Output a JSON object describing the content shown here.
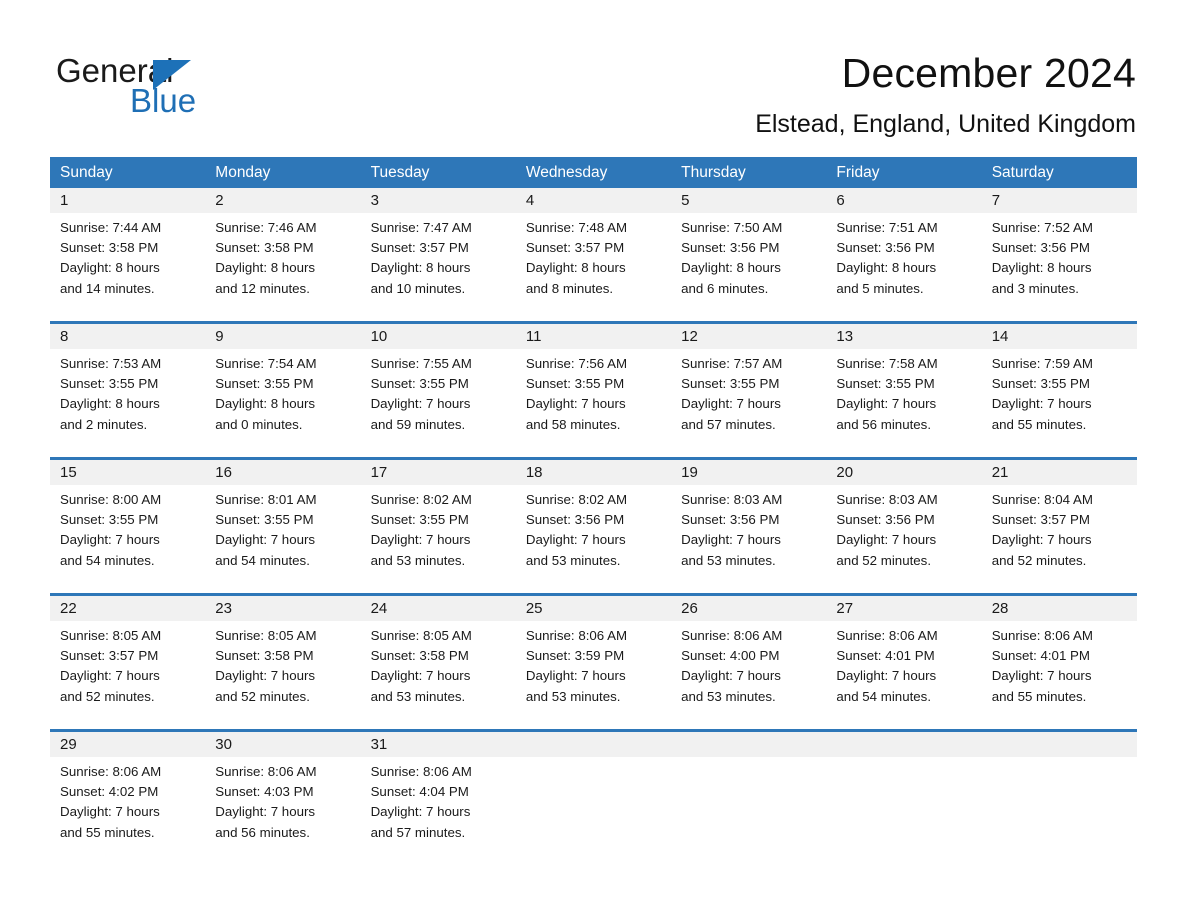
{
  "brand": {
    "name_part1": "General",
    "name_part2": "Blue",
    "accent_color": "#1d71b8"
  },
  "header": {
    "month_title": "December 2024",
    "location": "Elstead, England, United Kingdom"
  },
  "theme": {
    "header_blue": "#2e77b8",
    "date_band_gray": "#f1f1f1",
    "text_dark": "#1a1a1a"
  },
  "calendar": {
    "weekdays": [
      "Sunday",
      "Monday",
      "Tuesday",
      "Wednesday",
      "Thursday",
      "Friday",
      "Saturday"
    ],
    "weeks": [
      {
        "days": [
          {
            "date": "1",
            "sunrise": "Sunrise: 7:44 AM",
            "sunset": "Sunset: 3:58 PM",
            "daylight_line1": "Daylight: 8 hours",
            "daylight_line2": "and 14 minutes."
          },
          {
            "date": "2",
            "sunrise": "Sunrise: 7:46 AM",
            "sunset": "Sunset: 3:58 PM",
            "daylight_line1": "Daylight: 8 hours",
            "daylight_line2": "and 12 minutes."
          },
          {
            "date": "3",
            "sunrise": "Sunrise: 7:47 AM",
            "sunset": "Sunset: 3:57 PM",
            "daylight_line1": "Daylight: 8 hours",
            "daylight_line2": "and 10 minutes."
          },
          {
            "date": "4",
            "sunrise": "Sunrise: 7:48 AM",
            "sunset": "Sunset: 3:57 PM",
            "daylight_line1": "Daylight: 8 hours",
            "daylight_line2": "and 8 minutes."
          },
          {
            "date": "5",
            "sunrise": "Sunrise: 7:50 AM",
            "sunset": "Sunset: 3:56 PM",
            "daylight_line1": "Daylight: 8 hours",
            "daylight_line2": "and 6 minutes."
          },
          {
            "date": "6",
            "sunrise": "Sunrise: 7:51 AM",
            "sunset": "Sunset: 3:56 PM",
            "daylight_line1": "Daylight: 8 hours",
            "daylight_line2": "and 5 minutes."
          },
          {
            "date": "7",
            "sunrise": "Sunrise: 7:52 AM",
            "sunset": "Sunset: 3:56 PM",
            "daylight_line1": "Daylight: 8 hours",
            "daylight_line2": "and 3 minutes."
          }
        ]
      },
      {
        "days": [
          {
            "date": "8",
            "sunrise": "Sunrise: 7:53 AM",
            "sunset": "Sunset: 3:55 PM",
            "daylight_line1": "Daylight: 8 hours",
            "daylight_line2": "and 2 minutes."
          },
          {
            "date": "9",
            "sunrise": "Sunrise: 7:54 AM",
            "sunset": "Sunset: 3:55 PM",
            "daylight_line1": "Daylight: 8 hours",
            "daylight_line2": "and 0 minutes."
          },
          {
            "date": "10",
            "sunrise": "Sunrise: 7:55 AM",
            "sunset": "Sunset: 3:55 PM",
            "daylight_line1": "Daylight: 7 hours",
            "daylight_line2": "and 59 minutes."
          },
          {
            "date": "11",
            "sunrise": "Sunrise: 7:56 AM",
            "sunset": "Sunset: 3:55 PM",
            "daylight_line1": "Daylight: 7 hours",
            "daylight_line2": "and 58 minutes."
          },
          {
            "date": "12",
            "sunrise": "Sunrise: 7:57 AM",
            "sunset": "Sunset: 3:55 PM",
            "daylight_line1": "Daylight: 7 hours",
            "daylight_line2": "and 57 minutes."
          },
          {
            "date": "13",
            "sunrise": "Sunrise: 7:58 AM",
            "sunset": "Sunset: 3:55 PM",
            "daylight_line1": "Daylight: 7 hours",
            "daylight_line2": "and 56 minutes."
          },
          {
            "date": "14",
            "sunrise": "Sunrise: 7:59 AM",
            "sunset": "Sunset: 3:55 PM",
            "daylight_line1": "Daylight: 7 hours",
            "daylight_line2": "and 55 minutes."
          }
        ]
      },
      {
        "days": [
          {
            "date": "15",
            "sunrise": "Sunrise: 8:00 AM",
            "sunset": "Sunset: 3:55 PM",
            "daylight_line1": "Daylight: 7 hours",
            "daylight_line2": "and 54 minutes."
          },
          {
            "date": "16",
            "sunrise": "Sunrise: 8:01 AM",
            "sunset": "Sunset: 3:55 PM",
            "daylight_line1": "Daylight: 7 hours",
            "daylight_line2": "and 54 minutes."
          },
          {
            "date": "17",
            "sunrise": "Sunrise: 8:02 AM",
            "sunset": "Sunset: 3:55 PM",
            "daylight_line1": "Daylight: 7 hours",
            "daylight_line2": "and 53 minutes."
          },
          {
            "date": "18",
            "sunrise": "Sunrise: 8:02 AM",
            "sunset": "Sunset: 3:56 PM",
            "daylight_line1": "Daylight: 7 hours",
            "daylight_line2": "and 53 minutes."
          },
          {
            "date": "19",
            "sunrise": "Sunrise: 8:03 AM",
            "sunset": "Sunset: 3:56 PM",
            "daylight_line1": "Daylight: 7 hours",
            "daylight_line2": "and 53 minutes."
          },
          {
            "date": "20",
            "sunrise": "Sunrise: 8:03 AM",
            "sunset": "Sunset: 3:56 PM",
            "daylight_line1": "Daylight: 7 hours",
            "daylight_line2": "and 52 minutes."
          },
          {
            "date": "21",
            "sunrise": "Sunrise: 8:04 AM",
            "sunset": "Sunset: 3:57 PM",
            "daylight_line1": "Daylight: 7 hours",
            "daylight_line2": "and 52 minutes."
          }
        ]
      },
      {
        "days": [
          {
            "date": "22",
            "sunrise": "Sunrise: 8:05 AM",
            "sunset": "Sunset: 3:57 PM",
            "daylight_line1": "Daylight: 7 hours",
            "daylight_line2": "and 52 minutes."
          },
          {
            "date": "23",
            "sunrise": "Sunrise: 8:05 AM",
            "sunset": "Sunset: 3:58 PM",
            "daylight_line1": "Daylight: 7 hours",
            "daylight_line2": "and 52 minutes."
          },
          {
            "date": "24",
            "sunrise": "Sunrise: 8:05 AM",
            "sunset": "Sunset: 3:58 PM",
            "daylight_line1": "Daylight: 7 hours",
            "daylight_line2": "and 53 minutes."
          },
          {
            "date": "25",
            "sunrise": "Sunrise: 8:06 AM",
            "sunset": "Sunset: 3:59 PM",
            "daylight_line1": "Daylight: 7 hours",
            "daylight_line2": "and 53 minutes."
          },
          {
            "date": "26",
            "sunrise": "Sunrise: 8:06 AM",
            "sunset": "Sunset: 4:00 PM",
            "daylight_line1": "Daylight: 7 hours",
            "daylight_line2": "and 53 minutes."
          },
          {
            "date": "27",
            "sunrise": "Sunrise: 8:06 AM",
            "sunset": "Sunset: 4:01 PM",
            "daylight_line1": "Daylight: 7 hours",
            "daylight_line2": "and 54 minutes."
          },
          {
            "date": "28",
            "sunrise": "Sunrise: 8:06 AM",
            "sunset": "Sunset: 4:01 PM",
            "daylight_line1": "Daylight: 7 hours",
            "daylight_line2": "and 55 minutes."
          }
        ]
      },
      {
        "days": [
          {
            "date": "29",
            "sunrise": "Sunrise: 8:06 AM",
            "sunset": "Sunset: 4:02 PM",
            "daylight_line1": "Daylight: 7 hours",
            "daylight_line2": "and 55 minutes."
          },
          {
            "date": "30",
            "sunrise": "Sunrise: 8:06 AM",
            "sunset": "Sunset: 4:03 PM",
            "daylight_line1": "Daylight: 7 hours",
            "daylight_line2": "and 56 minutes."
          },
          {
            "date": "31",
            "sunrise": "Sunrise: 8:06 AM",
            "sunset": "Sunset: 4:04 PM",
            "daylight_line1": "Daylight: 7 hours",
            "daylight_line2": "and 57 minutes."
          },
          {
            "date": "",
            "sunrise": "",
            "sunset": "",
            "daylight_line1": "",
            "daylight_line2": ""
          },
          {
            "date": "",
            "sunrise": "",
            "sunset": "",
            "daylight_line1": "",
            "daylight_line2": ""
          },
          {
            "date": "",
            "sunrise": "",
            "sunset": "",
            "daylight_line1": "",
            "daylight_line2": ""
          },
          {
            "date": "",
            "sunrise": "",
            "sunset": "",
            "daylight_line1": "",
            "daylight_line2": ""
          }
        ]
      }
    ]
  }
}
